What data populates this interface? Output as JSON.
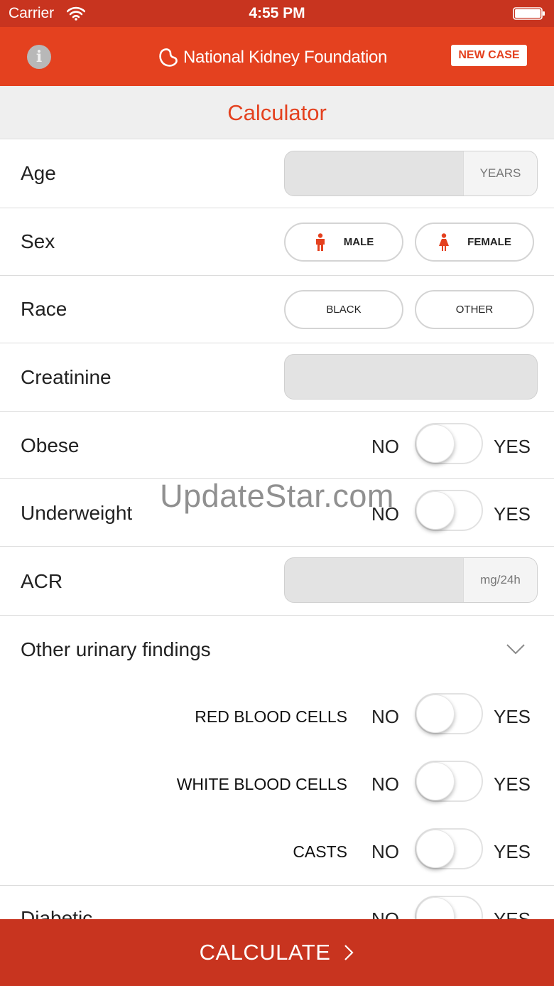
{
  "status_bar": {
    "carrier": "Carrier",
    "time": "4:55 PM",
    "wifi_icon": "wifi-icon",
    "battery_icon": "battery-icon"
  },
  "nav": {
    "info_icon": "info-icon",
    "logo_icon": "kidney-logo-icon",
    "brand_name": "National Kidney Foundation",
    "new_case_label": "NEW CASE"
  },
  "header": {
    "title": "Calculator"
  },
  "form": {
    "age": {
      "label": "Age",
      "value": "",
      "unit": "YEARS"
    },
    "sex": {
      "label": "Sex",
      "options": [
        "MALE",
        "FEMALE"
      ],
      "selected": null
    },
    "race": {
      "label": "Race",
      "options": [
        "BLACK",
        "OTHER"
      ],
      "selected": null
    },
    "creatinine": {
      "label": "Creatinine",
      "value": ""
    },
    "obese": {
      "label": "Obese",
      "no_label": "NO",
      "yes_label": "YES",
      "on": false
    },
    "underweight": {
      "label": "Underweight",
      "no_label": "NO",
      "yes_label": "YES",
      "on": false
    },
    "acr": {
      "label": "ACR",
      "value": "",
      "unit": "mg/24h"
    },
    "other_urinary": {
      "label": "Other urinary findings",
      "expanded": true,
      "items": [
        {
          "label": "RED BLOOD CELLS",
          "no_label": "NO",
          "yes_label": "YES",
          "on": false
        },
        {
          "label": "WHITE BLOOD CELLS",
          "no_label": "NO",
          "yes_label": "YES",
          "on": false
        },
        {
          "label": "CASTS",
          "no_label": "NO",
          "yes_label": "YES",
          "on": false
        }
      ]
    },
    "diabetic": {
      "label": "Diabetic",
      "no_label": "NO",
      "yes_label": "YES",
      "on": false
    }
  },
  "watermark": "UpdateStar.com",
  "footer": {
    "calculate_label": "CALCULATE"
  },
  "colors": {
    "brand": "#e4411f",
    "status_bar": "#c8341f",
    "footer": "#c8341f"
  }
}
